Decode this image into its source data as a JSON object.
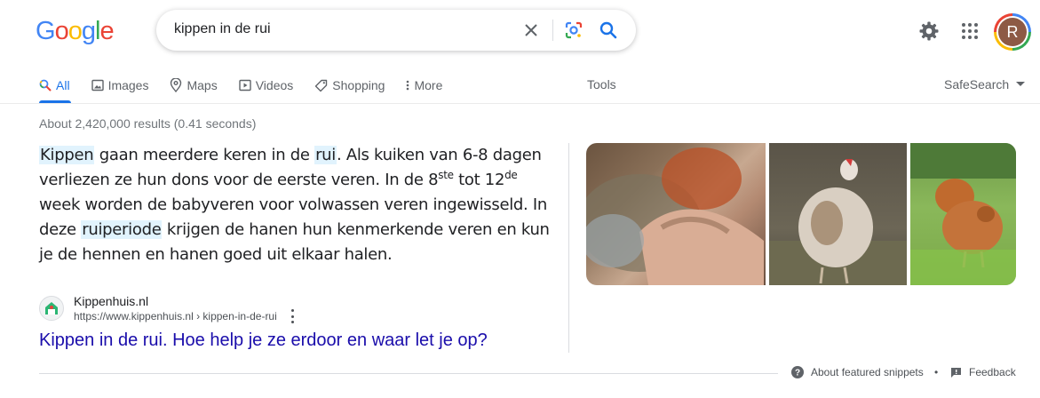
{
  "logo": {
    "text": [
      "G",
      "o",
      "o",
      "g",
      "l",
      "e"
    ],
    "colors": [
      "#4285f4",
      "#ea4335",
      "#fbbc04",
      "#4285f4",
      "#34a853",
      "#ea4335"
    ]
  },
  "search": {
    "query": "kippen in de rui"
  },
  "header": {
    "avatar_letter": "R"
  },
  "tabs": [
    {
      "label": "All",
      "icon": "search-icon"
    },
    {
      "label": "Images",
      "icon": "image-icon"
    },
    {
      "label": "Maps",
      "icon": "map-pin-icon"
    },
    {
      "label": "Videos",
      "icon": "play-icon"
    },
    {
      "label": "Shopping",
      "icon": "tag-icon"
    },
    {
      "label": "More",
      "icon": "more-vert-icon"
    }
  ],
  "tools_label": "Tools",
  "safesearch_label": "SafeSearch",
  "stats": "About 2,420,000 results (0.41 seconds)",
  "snippet": {
    "p1": "Kippen",
    "p2": " gaan meerdere keren in de ",
    "p3": "rui",
    "p4": ". Als kuiken van 6-8 dagen verliezen ze hun dons voor de eerste veren. In de 8",
    "p5": "ste",
    "p6": " tot 12",
    "p7": "de",
    "p8": " week worden de babyveren voor volwassen veren ingewisseld. In deze ",
    "p9": "ruiperiode",
    "p10": " krijgen de hanen hun kenmerkende veren en kun je de hennen en hanen goed uit elkaar halen."
  },
  "source": {
    "site_name": "Kippenhuis.nl",
    "url": "https://www.kippenhuis.nl › kippen-in-de-rui",
    "title": "Kippen in de rui. Hoe help je ze erdoor en waar let je op?"
  },
  "footer": {
    "about": "About featured snippets",
    "separator": "•",
    "feedback": "Feedback"
  },
  "colors": {
    "accent": "#1a73e8",
    "link": "#1a0dab",
    "highlight": "#e1f3fd"
  }
}
